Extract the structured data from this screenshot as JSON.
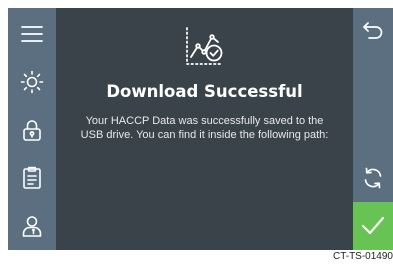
{
  "icons": {
    "sidebar": [
      "menu-icon",
      "brightness-icon",
      "lock-icon",
      "clipboard-icon",
      "user-icon"
    ],
    "right": [
      "back-icon",
      "refresh-icon",
      "checkmark-icon"
    ],
    "illustration": "chart-check-icon"
  },
  "colors": {
    "panel_bg": "#3b434a",
    "sidebar_bg": "#5b6f80",
    "confirm_bg": "#67c354",
    "text": "#ffffff"
  },
  "dialog": {
    "title": "Download Successful",
    "message": "Your HACCP Data was successfully saved to the USB drive. You can find it inside the following path:"
  },
  "footer": {
    "doc_id": "CT-TS-01490"
  }
}
